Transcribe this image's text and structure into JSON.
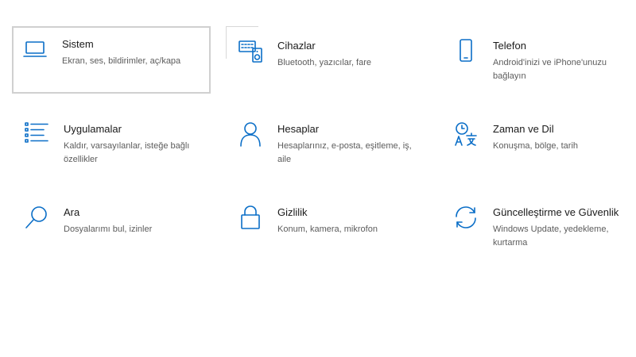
{
  "tiles": [
    {
      "title": "Sistem",
      "desc": "Ekran, ses, bildirimler, aç/kapa",
      "icon": "laptop-icon"
    },
    {
      "title": "Cihazlar",
      "desc": "Bluetooth, yazıcılar, fare",
      "icon": "devices-icon"
    },
    {
      "title": "Telefon",
      "desc": "Android'inizi ve iPhone'unuzu bağlayın",
      "icon": "phone-icon"
    },
    {
      "title": "Uygulamalar",
      "desc": "Kaldır, varsayılanlar, isteğe bağlı özellikler",
      "icon": "apps-list-icon"
    },
    {
      "title": "Hesaplar",
      "desc": "Hesaplarınız, e-posta, eşitleme, iş, aile",
      "icon": "person-icon"
    },
    {
      "title": "Zaman ve Dil",
      "desc": "Konuşma, bölge, tarih",
      "icon": "time-language-icon"
    },
    {
      "title": "Ara",
      "desc": "Dosyalarımı bul, izinler",
      "icon": "search-icon"
    },
    {
      "title": "Gizlilik",
      "desc": "Konum, kamera, mikrofon",
      "icon": "lock-icon"
    },
    {
      "title": "Güncelleştirme ve Güvenlik",
      "desc": "Windows Update, yedekleme, kurtarma",
      "icon": "sync-icon"
    }
  ],
  "accent_color": "#0a6ec7"
}
